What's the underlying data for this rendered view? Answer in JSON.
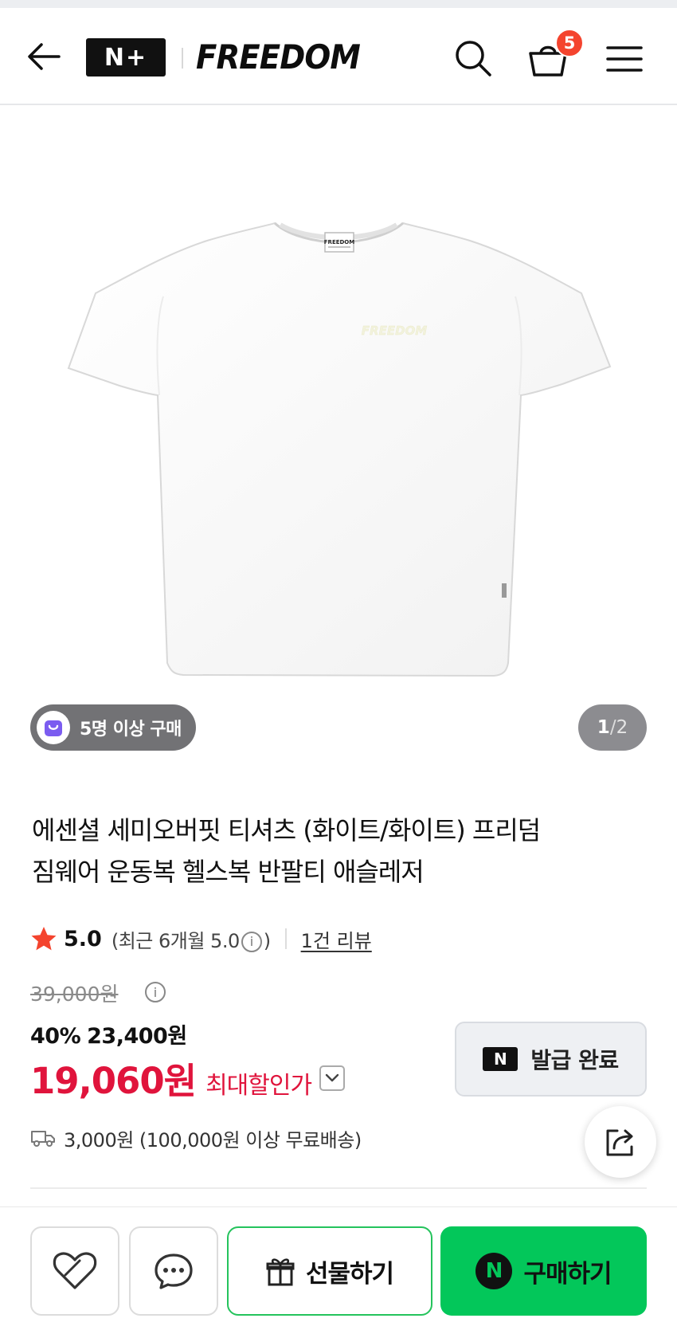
{
  "header": {
    "nplus_logo": "N+",
    "brand_name": "FREEDOM",
    "cart_count": "5"
  },
  "product_image": {
    "tag_text": "FREEDOM",
    "print_text": "FREEDOM",
    "purchase_badge": "5명 이상 구매",
    "image_index": "1",
    "image_separator": "/",
    "image_total": "2"
  },
  "product": {
    "title_line1": "에센셜 세미오버핏 티셔츠 (화이트/화이트) 프리덤",
    "title_line2": "짐웨어 운동복 헬스복 반팔티 애슬레저"
  },
  "rating": {
    "score": "5.0",
    "recent_prefix": "(최근 6개월 5.0",
    "recent_suffix": ")",
    "review_link": "1건 리뷰"
  },
  "price": {
    "original": "39,000원",
    "discount_percent": "40%",
    "discount_price": "23,400원",
    "max_discount_price": "19,060원",
    "max_discount_label": "최대할인가"
  },
  "coupon": {
    "badge": "N",
    "label": "발급 완료"
  },
  "shipping": {
    "text": "3,000원 (100,000원 이상 무료배송)"
  },
  "bottom_bar": {
    "gift_label": "선물하기",
    "buy_badge": "N",
    "buy_label": "구매하기"
  },
  "colors": {
    "accent_red": "#e0143c",
    "naver_green": "#03c75a",
    "badge_red": "#f4442e",
    "star": "#f4442e"
  }
}
